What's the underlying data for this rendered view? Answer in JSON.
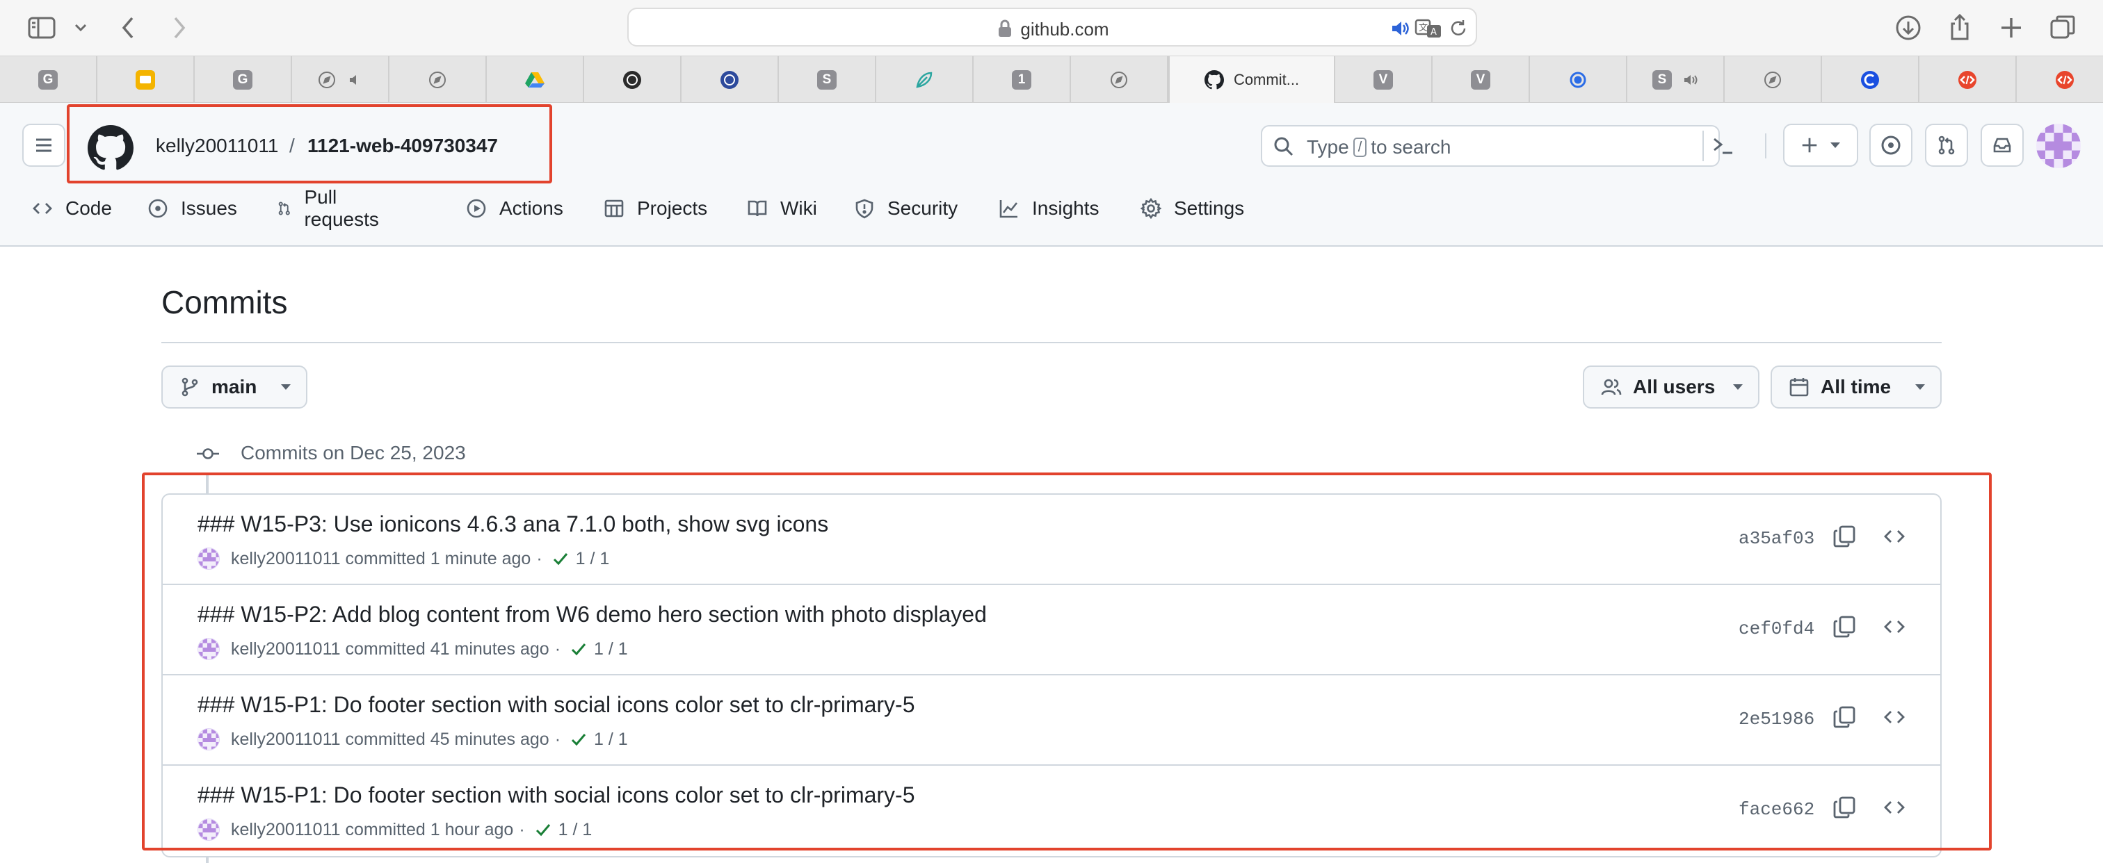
{
  "browser": {
    "url": "github.com",
    "active_tab_title": "Commit..."
  },
  "tabs": [
    {
      "kind": "letter",
      "letter": "G",
      "color": "#8e8e93"
    },
    {
      "kind": "slides",
      "color": "#f4b400"
    },
    {
      "kind": "letter",
      "letter": "G",
      "color": "#8e8e93"
    },
    {
      "kind": "compass-audio"
    },
    {
      "kind": "compass"
    },
    {
      "kind": "drive"
    },
    {
      "kind": "badge-dark"
    },
    {
      "kind": "badge-blue"
    },
    {
      "kind": "letter",
      "letter": "S",
      "color": "#8e8e93"
    },
    {
      "kind": "leaf"
    },
    {
      "kind": "letter",
      "letter": "1",
      "color": "#8e8e93"
    },
    {
      "kind": "compass"
    },
    {
      "kind": "github-active"
    },
    {
      "kind": "letter",
      "letter": "V",
      "color": "#8e8e93"
    },
    {
      "kind": "letter",
      "letter": "V",
      "color": "#8e8e93"
    },
    {
      "kind": "g-ring"
    },
    {
      "kind": "letter-audio",
      "letter": "S",
      "color": "#8e8e93"
    },
    {
      "kind": "compass"
    },
    {
      "kind": "c-blue"
    },
    {
      "kind": "code-red"
    },
    {
      "kind": "code-red"
    }
  ],
  "header": {
    "owner": "kelly20011011",
    "separator": "/",
    "repo": "1121-web-409730347",
    "search_prefix": "Type",
    "search_key": "/",
    "search_suffix": "to search"
  },
  "nav": {
    "items": [
      {
        "label": "Code",
        "icon": "code-icon"
      },
      {
        "label": "Issues",
        "icon": "issue-icon"
      },
      {
        "label": "Pull requests",
        "icon": "pull-request-icon"
      },
      {
        "label": "Actions",
        "icon": "play-icon"
      },
      {
        "label": "Projects",
        "icon": "table-icon"
      },
      {
        "label": "Wiki",
        "icon": "book-icon"
      },
      {
        "label": "Security",
        "icon": "shield-icon"
      },
      {
        "label": "Insights",
        "icon": "graph-icon"
      },
      {
        "label": "Settings",
        "icon": "gear-icon"
      }
    ]
  },
  "main": {
    "title": "Commits",
    "branch": "main",
    "users_filter": "All users",
    "time_filter": "All time",
    "group_label": "Commits on Dec 25, 2023",
    "committed_word": "committed",
    "commits": [
      {
        "message": "### W15-P3: Use ionicons 4.6.3 ana 7.1.0 both, show svg icons",
        "author": "kelly20011011",
        "time": "1 minute ago",
        "checks": "1 / 1",
        "sha": "a35af03"
      },
      {
        "message": "### W15-P2: Add blog content from W6 demo hero section with photo displayed",
        "author": "kelly20011011",
        "time": "41 minutes ago",
        "checks": "1 / 1",
        "sha": "cef0fd4"
      },
      {
        "message": "### W15-P1: Do footer section with social icons color set to clr-primary-5",
        "author": "kelly20011011",
        "time": "45 minutes ago",
        "checks": "1 / 1",
        "sha": "2e51986"
      },
      {
        "message": "### W15-P1: Do footer section with social icons color set to clr-primary-5",
        "author": "kelly20011011",
        "time": "1 hour ago",
        "checks": "1 / 1",
        "sha": "face662"
      }
    ]
  },
  "colors": {
    "highlight": "#e2432d",
    "check_green": "#1a7f37",
    "muted": "#59636e",
    "border": "#d0d7de"
  }
}
